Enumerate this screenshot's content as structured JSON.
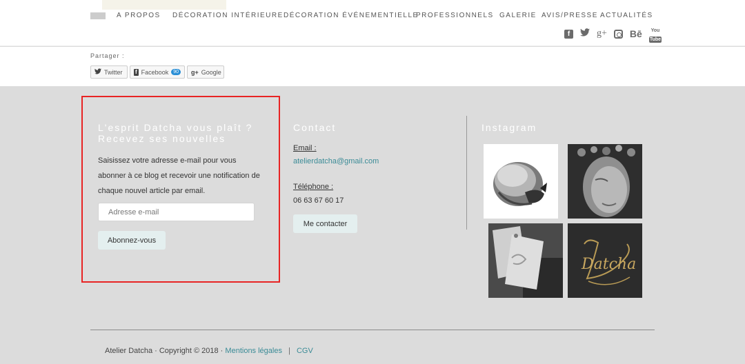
{
  "header": {
    "nav": [
      "A PROPOS",
      "DÉCORATION INTÉRIEURE",
      "DÉCORATION ÉVÉNEMENTIELLE",
      "PROFESSIONNELS",
      "GALERIE",
      "AVIS/PRESSE",
      "ACTUALITÉS"
    ],
    "social_icons": [
      "facebook-icon",
      "twitter-icon",
      "google-plus-icon",
      "instagram-icon",
      "behance-icon",
      "youtube-icon"
    ],
    "social_glyphs": {
      "facebook": "f",
      "twitter": "🐦",
      "google_plus": "g+",
      "behance": "Bē",
      "youtube_top": "You",
      "youtube_bottom": "Tube"
    }
  },
  "share": {
    "label": "Partager :",
    "twitter": "Twitter",
    "facebook": "Facebook",
    "facebook_count": "90",
    "google": "Google"
  },
  "newsletter": {
    "title_line1": "L'esprit Datcha vous plaît ?",
    "title_line2": "Recevez ses nouvelles",
    "description": "Saisissez votre adresse e-mail pour vous abonner à ce blog et recevoir une notification de chaque nouvel article par email.",
    "email_placeholder": "Adresse e-mail",
    "subscribe_label": "Abonnez-vous"
  },
  "contact": {
    "title": "Contact",
    "email_label": "Email :",
    "email": "atelierdatcha@gmail.com",
    "phone_label": "Téléphone :",
    "phone": "06 63 67 60 17",
    "button": "Me contacter"
  },
  "instagram": {
    "title": "Instagram",
    "images": [
      "sleeping-fox-drawing",
      "woman-portrait-flower-crown",
      "carved-tags",
      "datcha-gold-calligraphy"
    ],
    "calligraphy_text": "Datcha"
  },
  "footer": {
    "copyright": "Atelier Datcha · Copyright © 2018 ·",
    "mentions": "Mentions légales",
    "separator": "|",
    "cgv": "CGV"
  },
  "colors": {
    "footer_bg": "#dcdcdc",
    "link": "#3a8b96",
    "highlight_border": "#e82323",
    "button_bg": "#e4efef"
  }
}
